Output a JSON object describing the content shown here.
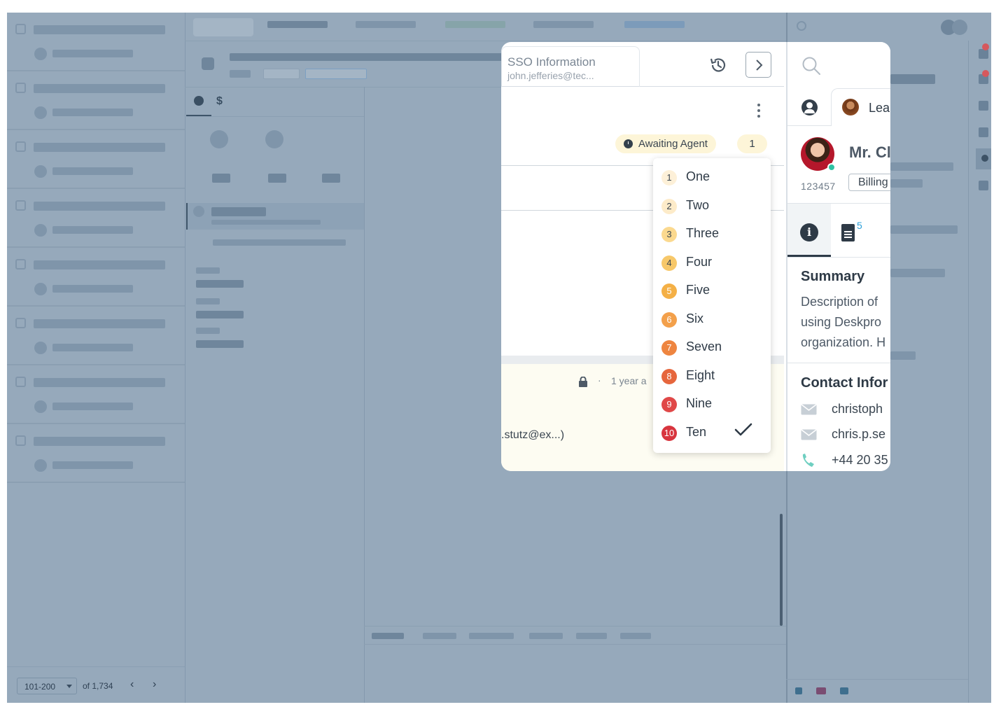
{
  "sso": {
    "title": "SSO Information",
    "subtitle": "john.jefferies@tec..."
  },
  "ticket": {
    "status": "Awaiting Agent",
    "count": "1",
    "meta_dot": "·",
    "time_ago": "1 year a",
    "email_truncated": ".stutz@ex...)"
  },
  "dropdown": {
    "options": [
      {
        "num": "1",
        "label": "One",
        "bg": "#fdf0d8",
        "fg": "#3b4651"
      },
      {
        "num": "2",
        "label": "Two",
        "bg": "#fdebc9",
        "fg": "#3b4651"
      },
      {
        "num": "3",
        "label": "Three",
        "bg": "#fbd98f",
        "fg": "#3b4651"
      },
      {
        "num": "4",
        "label": "Four",
        "bg": "#f7c86a",
        "fg": "#3b4651"
      },
      {
        "num": "5",
        "label": "Five",
        "bg": "#f4b046",
        "fg": "#ffffff"
      },
      {
        "num": "6",
        "label": "Six",
        "bg": "#f3a04b",
        "fg": "#ffffff"
      },
      {
        "num": "7",
        "label": "Seven",
        "bg": "#ee8540",
        "fg": "#ffffff"
      },
      {
        "num": "8",
        "label": "Eight",
        "bg": "#e6663d",
        "fg": "#ffffff"
      },
      {
        "num": "9",
        "label": "Nine",
        "bg": "#e04848",
        "fg": "#ffffff"
      },
      {
        "num": "10",
        "label": "Ten",
        "bg": "#d8353e",
        "fg": "#ffffff"
      }
    ],
    "selected": "Ten"
  },
  "profile": {
    "lead_tab": "Lea",
    "name": "Mr. Cl",
    "id": "123457",
    "badge": "Billing",
    "doc_count": "5",
    "summary_heading": "Summary",
    "summary_lines": [
      "Description of",
      "using Deskpro",
      "organization. H"
    ],
    "contact_heading": "Contact Infor",
    "contacts": [
      {
        "type": "email",
        "value": "christoph"
      },
      {
        "type": "email",
        "value": "chris.p.se"
      },
      {
        "type": "phone",
        "value": "+44 20 35"
      }
    ]
  },
  "pager": {
    "range": "101-200",
    "total": "of 1,734",
    "prev": "‹",
    "next": "›"
  },
  "icons": {
    "history": "history-icon",
    "next": "chevron-right-icon",
    "search": "search-icon",
    "lock": "lock-icon",
    "check": "check-icon"
  },
  "colors": {
    "overlay": "#96a9bb",
    "status_bg": "#fdf5d8",
    "accent_blue": "#2da0d9",
    "online": "#2fc2a3"
  }
}
